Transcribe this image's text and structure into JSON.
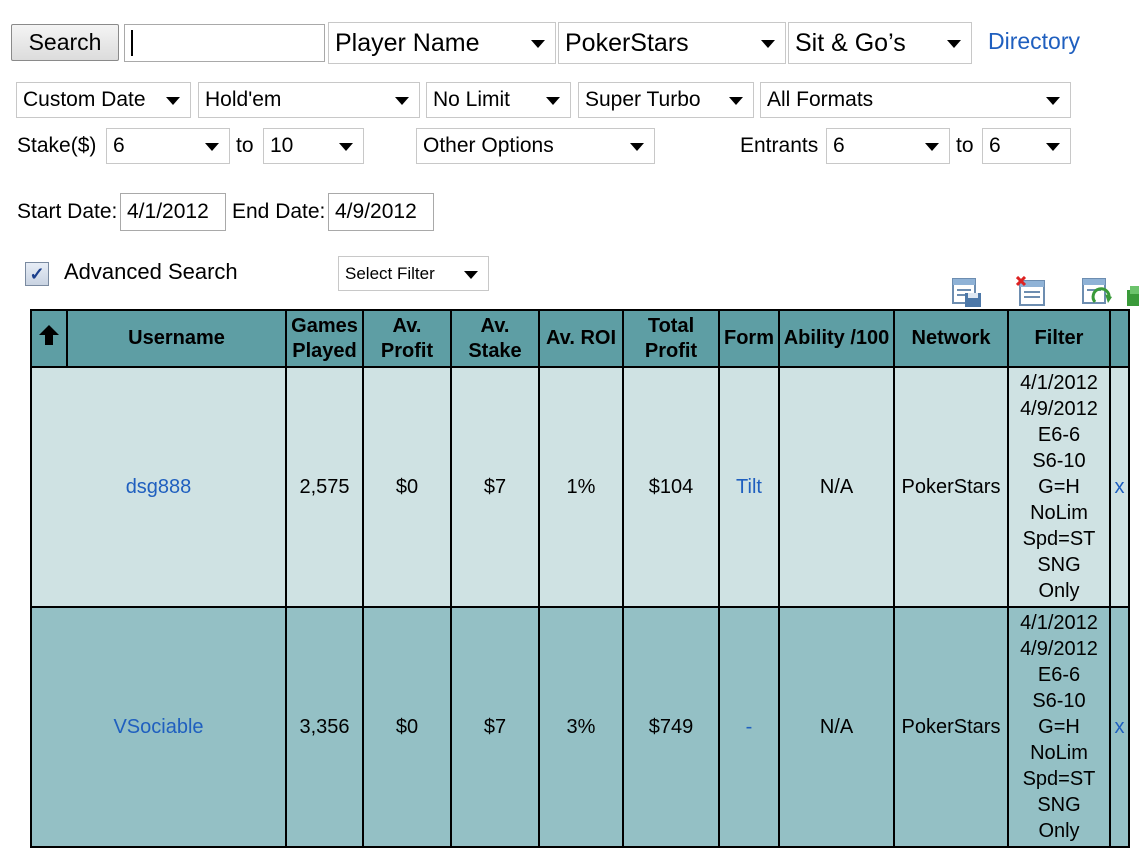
{
  "search": {
    "button_label": "Search",
    "query_value": "",
    "search_by": "Player Name",
    "network": "PokerStars",
    "game_category": "Sit & Go’s",
    "directory_link": "Directory"
  },
  "filters": {
    "date_range": "Custom Date",
    "game": "Hold'em",
    "limit": "No Limit",
    "speed": "Super Turbo",
    "format": "All Formats",
    "stake_label": "Stake($)",
    "stake_from": "6",
    "stake_to_label": "to",
    "stake_to": "10",
    "other_options": "Other Options",
    "entrants_label": "Entrants",
    "entrants_from": "6",
    "entrants_to_label": "to",
    "entrants_to": "6",
    "start_date_label": "Start Date:",
    "start_date": "4/1/2012",
    "end_date_label": "End Date:",
    "end_date": "4/9/2012",
    "advanced_search_label": "Advanced Search",
    "advanced_search_checked": true,
    "select_filter": "Select Filter"
  },
  "toolbar": {
    "icons": [
      "save-filter-icon",
      "delete-filter-icon",
      "refresh-filter-icon",
      "export-icon"
    ]
  },
  "table": {
    "columns": [
      "",
      "Username",
      "Games Played",
      "Av. Profit",
      "Av. Stake",
      "Av. ROI",
      "Total Profit",
      "Form",
      "Ability /100",
      "Network",
      "Filter",
      ""
    ],
    "rows": [
      {
        "username": "dsg888",
        "games_played": "2,575",
        "av_profit": "$0",
        "av_stake": "$7",
        "av_roi": "1%",
        "total_profit": "$104",
        "form": "Tilt",
        "ability": "N/A",
        "network": "PokerStars",
        "filter": [
          "4/1/2012",
          "4/9/2012",
          "E6-6",
          "S6-10",
          "G=H",
          "NoLim",
          "Spd=ST",
          "SNG",
          "Only"
        ],
        "remove": "x"
      },
      {
        "username": "VSociable",
        "games_played": "3,356",
        "av_profit": "$0",
        "av_stake": "$7",
        "av_roi": "3%",
        "total_profit": "$749",
        "form": "-",
        "ability": "N/A",
        "network": "PokerStars",
        "filter": [
          "4/1/2012",
          "4/9/2012",
          "E6-6",
          "S6-10",
          "G=H",
          "NoLim",
          "Spd=ST",
          "SNG",
          "Only"
        ],
        "remove": "x"
      }
    ]
  },
  "colors": {
    "header_bg": "#5e9ea4",
    "row_light": "#cfe2e3",
    "row_dark": "#94c0c5",
    "link": "#1f5fbf"
  }
}
